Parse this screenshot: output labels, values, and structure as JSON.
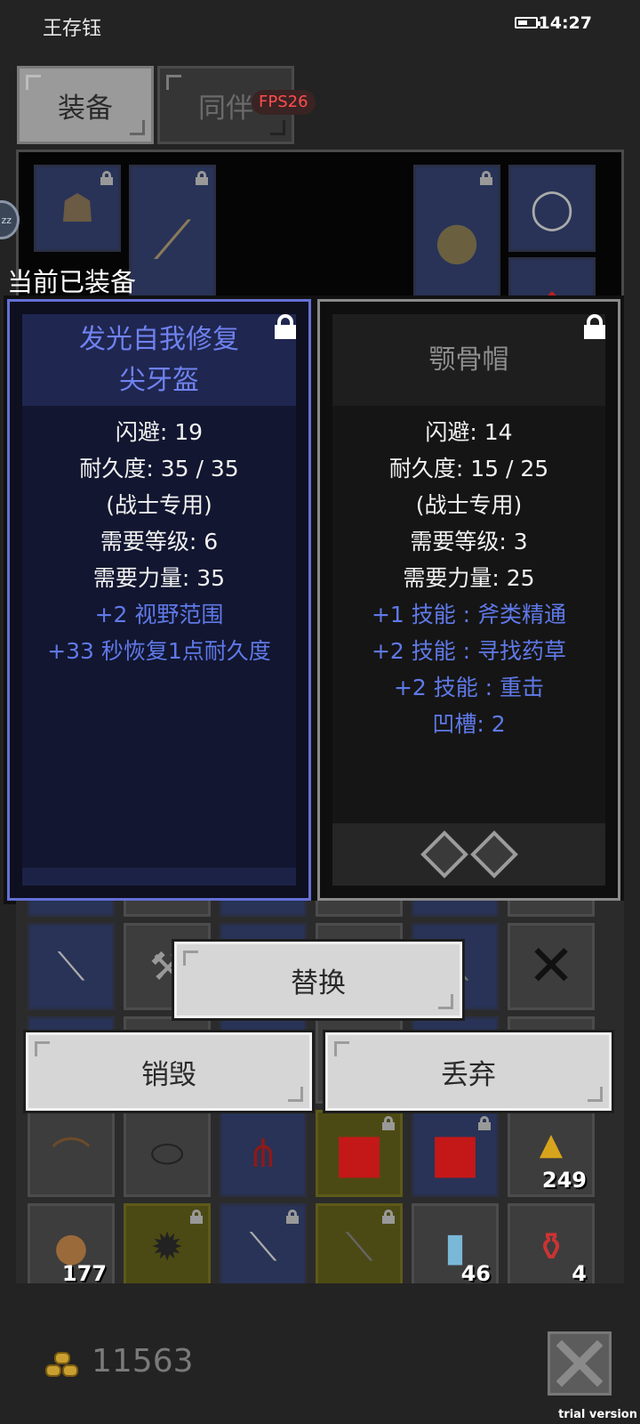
{
  "status_bar": {
    "title": "王存钰",
    "time": "14:27"
  },
  "tabs": [
    {
      "label": "装备",
      "active": true
    },
    {
      "label": "同伴",
      "active": false
    }
  ],
  "fps": "FPS26",
  "current_equipped_label": "当前已装备",
  "compare": {
    "equipped": {
      "name_lines": [
        "发光自我修复",
        "尖牙盔"
      ],
      "locked": true,
      "stats": [
        {
          "text": "闪避: 19",
          "kind": "base"
        },
        {
          "text": "耐久度: 35 / 35",
          "kind": "base"
        },
        {
          "text": "(战士专用)",
          "kind": "base"
        },
        {
          "text": "需要等级: 6",
          "kind": "base"
        },
        {
          "text": "需要力量: 35",
          "kind": "base"
        },
        {
          "text": "+2 视野范围",
          "kind": "bonus"
        },
        {
          "text": "+33 秒恢复1点耐久度",
          "kind": "bonus"
        }
      ]
    },
    "selected": {
      "name_lines": [
        "颚骨帽"
      ],
      "locked": true,
      "stats": [
        {
          "text": "闪避: 14",
          "kind": "base"
        },
        {
          "text": "耐久度: 15 / 25",
          "kind": "base"
        },
        {
          "text": "(战士专用)",
          "kind": "base"
        },
        {
          "text": "需要等级: 3",
          "kind": "base"
        },
        {
          "text": "需要力量: 25",
          "kind": "base"
        },
        {
          "text": "+1 技能 : 斧类精通",
          "kind": "bonus"
        },
        {
          "text": "+2 技能 : 寻找药草",
          "kind": "bonus"
        },
        {
          "text": "+2 技能 : 重击",
          "kind": "bonus"
        },
        {
          "text": "凹槽: 2",
          "kind": "bonus"
        }
      ],
      "sockets": 2
    }
  },
  "actions": {
    "replace": "替换",
    "destroy": "销毁",
    "drop": "丢弃"
  },
  "inventory_counts": {
    "gold_pile": "249",
    "meat": "177",
    "scroll": "46",
    "potion": "4"
  },
  "gold": "11563",
  "watermark": "trial version",
  "colors": {
    "bonus_text": "#5f79e8",
    "equipped_border": "#6470d6",
    "fps_text": "#ff4d4d"
  }
}
